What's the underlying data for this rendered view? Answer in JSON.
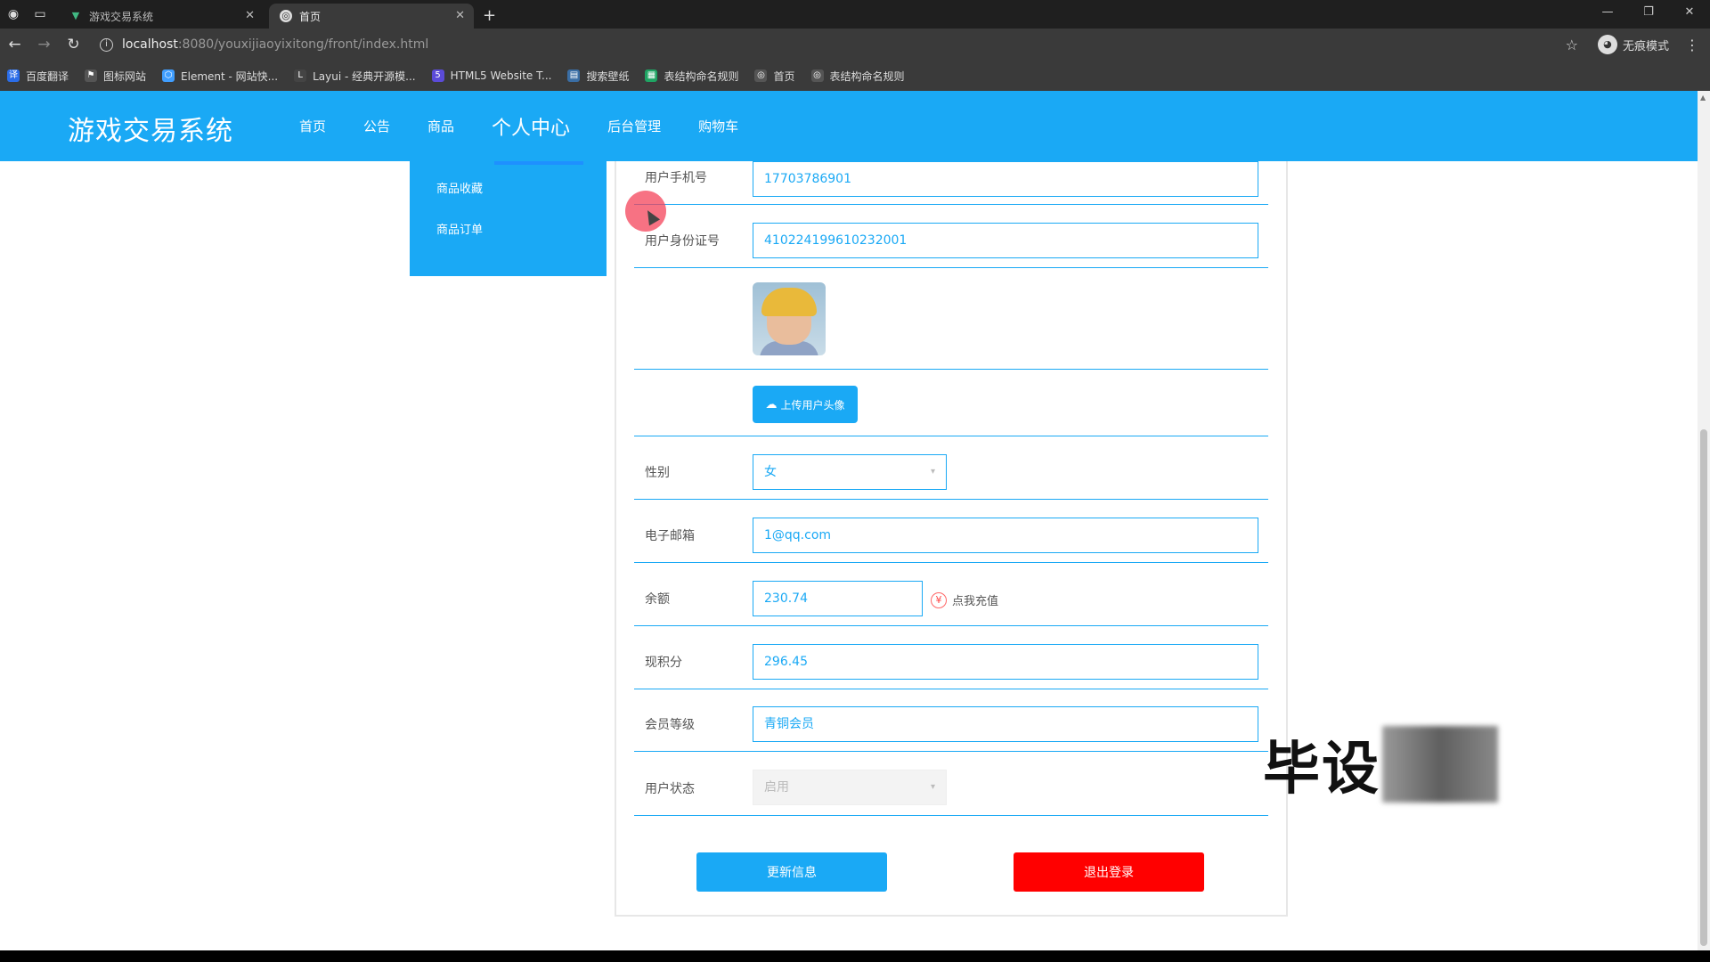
{
  "browser": {
    "tabs": [
      {
        "title": "游戏交易系统",
        "active": false
      },
      {
        "title": "首页",
        "active": true
      }
    ],
    "new_tab": "+",
    "url_host": "localhost",
    "url_path": ":8080/youxijiaoyixitong/front/index.html",
    "incognito_label": "无痕模式",
    "bookmarks": [
      {
        "label": "百度翻译",
        "icon": "translate-icon",
        "color": "#2b6de8"
      },
      {
        "label": "图标网站",
        "icon": "flag-icon",
        "color": "#555555"
      },
      {
        "label": "Element - 网站快...",
        "icon": "element-icon",
        "color": "#409eff"
      },
      {
        "label": "Layui - 经典开源模...",
        "icon": "layui-icon",
        "color": "#444444"
      },
      {
        "label": "HTML5 Website T...",
        "icon": "html5-icon",
        "color": "#5b4bd8"
      },
      {
        "label": "搜索壁纸",
        "icon": "wallpaper-icon",
        "color": "#3a6ea5"
      },
      {
        "label": "表结构命名规则",
        "icon": "doc-icon",
        "color": "#1fa463"
      },
      {
        "label": "首页",
        "icon": "globe-icon",
        "color": "#555555"
      },
      {
        "label": "表结构命名规则",
        "icon": "globe-icon",
        "color": "#555555"
      }
    ]
  },
  "site": {
    "logo": "游戏交易系统",
    "nav": [
      "首页",
      "公告",
      "商品",
      "个人中心",
      "后台管理",
      "购物车"
    ],
    "side_menu": [
      "商品收藏",
      "商品订单"
    ]
  },
  "form": {
    "phone_label": "用户手机号",
    "phone_value": "17703786901",
    "idcard_label": "用户身份证号",
    "idcard_value": "410224199610232001",
    "upload_label": "上传用户头像",
    "gender_label": "性别",
    "gender_value": "女",
    "email_label": "电子邮箱",
    "email_value": "1@qq.com",
    "balance_label": "余额",
    "balance_value": "230.74",
    "recharge_label": "点我充值",
    "points_label": "现积分",
    "points_value": "296.45",
    "level_label": "会员等级",
    "level_value": "青铜会员",
    "status_label": "用户状态",
    "status_value": "启用",
    "update_button": "更新信息",
    "logout_button": "退出登录"
  },
  "watermark": "毕设",
  "colors": {
    "primary": "#1aa9f5",
    "danger": "#ff0000"
  }
}
